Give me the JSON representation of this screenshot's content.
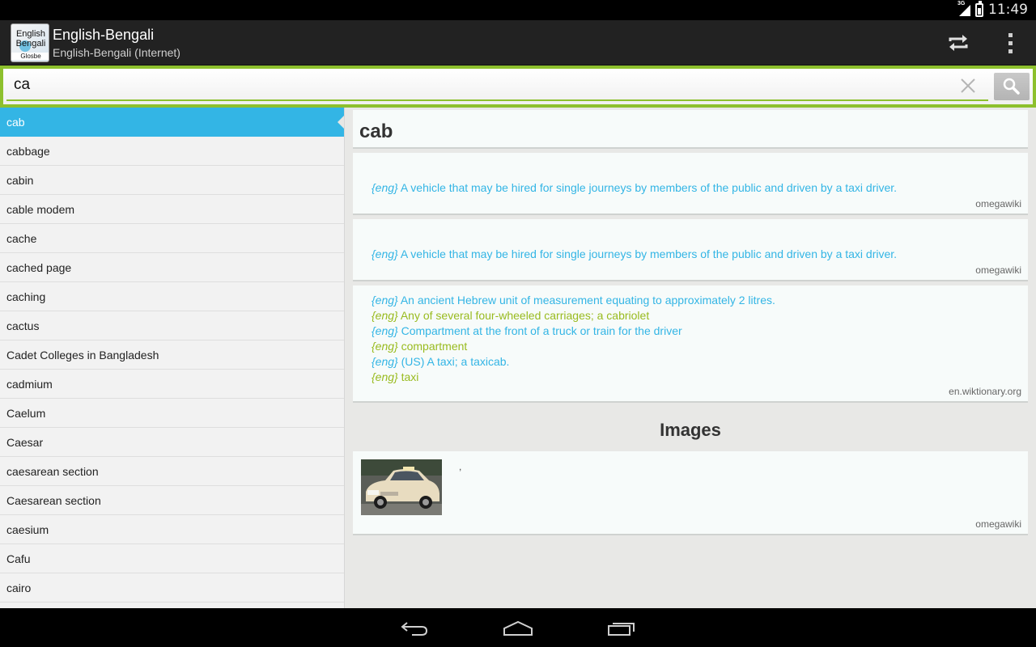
{
  "status_bar": {
    "network": "3G",
    "time": "11:49"
  },
  "app": {
    "logo_text": [
      "English",
      "Bengali",
      "Glosbe"
    ],
    "title": "English-Bengali",
    "subtitle": "English-Bengali (Internet)",
    "accent_color": "#8dc02d",
    "selection_color": "#33b5e5"
  },
  "toolbar": {
    "icons": [
      "swap-languages-icon",
      "overflow-menu-icon"
    ]
  },
  "search": {
    "value": "ca",
    "icons": [
      "clear-icon",
      "search-icon"
    ]
  },
  "word_list": {
    "selected_index": 0,
    "items": [
      "cab",
      "cabbage",
      "cabin",
      "cable modem",
      "cache",
      "cached page",
      "caching",
      "cactus",
      "Cadet Colleges in Bangladesh",
      "cadmium",
      "Caelum",
      "Caesar",
      "caesarean section",
      "Caesarean section",
      "caesium",
      "Cafu",
      "cairo"
    ]
  },
  "detail": {
    "headword": "cab",
    "cards": [
      {
        "definitions": [
          {
            "lang": "{eng}",
            "text": "A vehicle that may be hired for single journeys by members of the public and driven by a taxi driver.",
            "color": "blue"
          }
        ],
        "source": "omegawiki"
      },
      {
        "definitions": [
          {
            "lang": "{eng}",
            "text": "A vehicle that may be hired for single journeys by members of the public and driven by a taxi driver.",
            "color": "blue"
          }
        ],
        "source": "omegawiki"
      },
      {
        "definitions": [
          {
            "lang": "{eng}",
            "text": "An ancient Hebrew unit of measurement equating to approximately 2 litres.",
            "color": "blue"
          },
          {
            "lang": "{eng}",
            "text": "Any of several four-wheeled carriages; a cabriolet",
            "color": "green"
          },
          {
            "lang": "{eng}",
            "text": "Compartment at the front of a truck or train for the driver",
            "color": "blue"
          },
          {
            "lang": "{eng}",
            "text": "compartment",
            "color": "green"
          },
          {
            "lang": "{eng}",
            "text": "(US) A taxi; a taxicab.",
            "color": "blue"
          },
          {
            "lang": "{eng}",
            "text": "taxi",
            "color": "green"
          }
        ],
        "source": "en.wiktionary.org"
      }
    ],
    "images_heading": "Images",
    "image_card": {
      "caption": ",",
      "source": "omegawiki"
    }
  },
  "nav_bar": {
    "icons": [
      "back-icon",
      "home-icon",
      "recent-apps-icon"
    ]
  }
}
